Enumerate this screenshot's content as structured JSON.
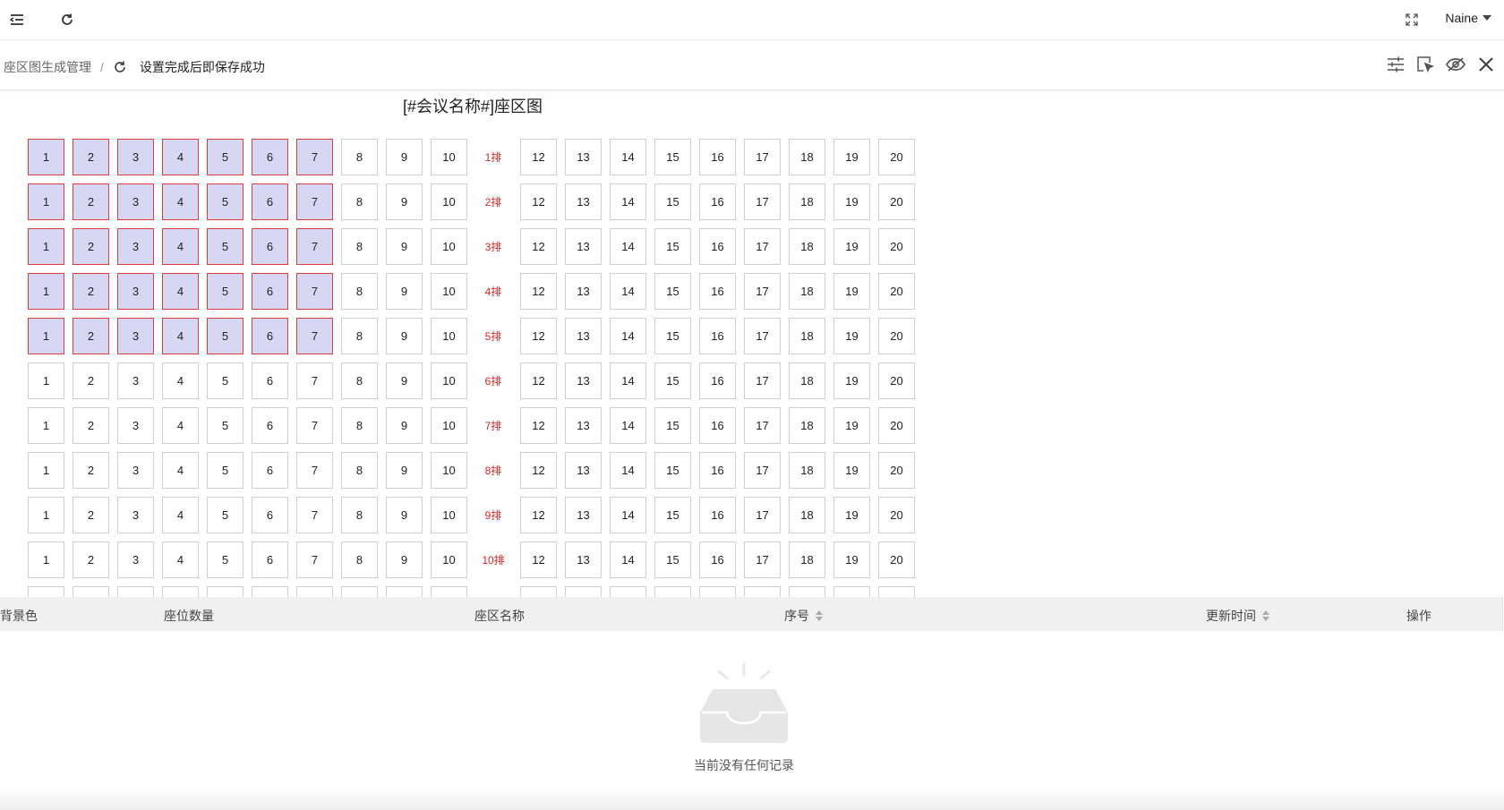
{
  "header": {
    "user_name": "Naine",
    "icons": [
      "menu-fold-icon",
      "refresh-icon",
      "fullscreen-icon"
    ]
  },
  "breadcrumb": {
    "parent": "座区图生成管理",
    "separator": "/",
    "current": "设置完成后即保存成功"
  },
  "toolbar": {
    "icons": [
      "settings-sliders-icon",
      "select-area-icon",
      "eye-hide-icon",
      "close-icon"
    ]
  },
  "seat_map": {
    "title": "[#会议名称#]座区图",
    "seats_left": [
      "1",
      "2",
      "3",
      "4",
      "5",
      "6",
      "7",
      "8",
      "9",
      "10"
    ],
    "seats_right": [
      "12",
      "13",
      "14",
      "15",
      "16",
      "17",
      "18",
      "19",
      "20"
    ],
    "rows": [
      {
        "label": "1排",
        "selected": [
          "1",
          "2",
          "3",
          "4",
          "5",
          "6",
          "7"
        ]
      },
      {
        "label": "2排",
        "selected": [
          "1",
          "2",
          "3",
          "4",
          "5",
          "6",
          "7"
        ]
      },
      {
        "label": "3排",
        "selected": [
          "1",
          "2",
          "3",
          "4",
          "5",
          "6",
          "7"
        ]
      },
      {
        "label": "4排",
        "selected": [
          "1",
          "2",
          "3",
          "4",
          "5",
          "6",
          "7"
        ]
      },
      {
        "label": "5排",
        "selected": [
          "1",
          "2",
          "3",
          "4",
          "5",
          "6",
          "7"
        ]
      },
      {
        "label": "6排",
        "selected": []
      },
      {
        "label": "7排",
        "selected": []
      },
      {
        "label": "8排",
        "selected": []
      },
      {
        "label": "9排",
        "selected": []
      },
      {
        "label": "10排",
        "selected": []
      },
      {
        "label": "",
        "selected": []
      }
    ],
    "selected_fill": "#d6d8f3",
    "selected_border": "#e03b3b",
    "row_label_color": "#e02020"
  },
  "table": {
    "columns": [
      {
        "label": "背景色",
        "sortable": false
      },
      {
        "label": "座位数量",
        "sortable": false
      },
      {
        "label": "座区名称",
        "sortable": false
      },
      {
        "label": "序号",
        "sortable": true
      },
      {
        "label": "更新时间",
        "sortable": true
      },
      {
        "label": "操作",
        "sortable": false
      }
    ],
    "empty_text": "当前没有任何记录"
  }
}
